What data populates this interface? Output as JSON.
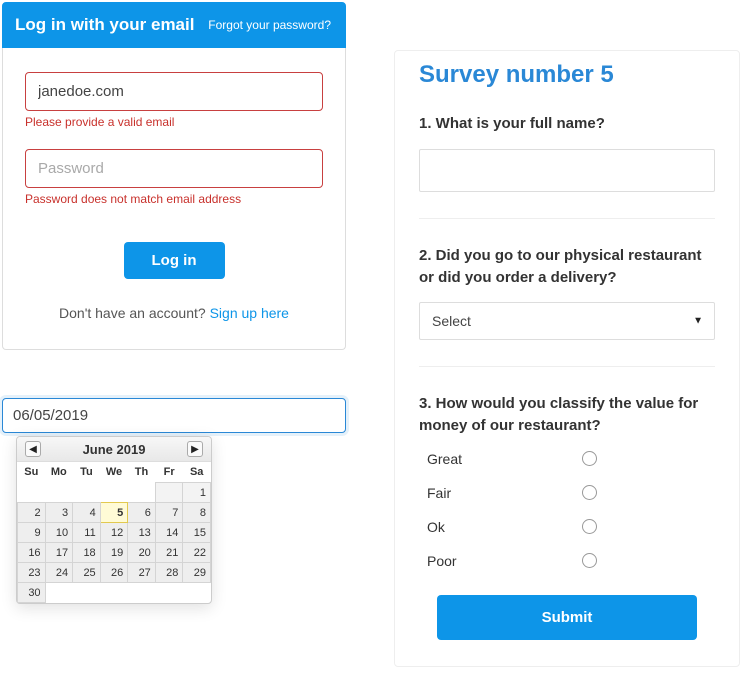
{
  "login": {
    "title": "Log in with your email",
    "forgot": "Forgot your password?",
    "email_value": "janedoe.com",
    "email_error": "Please provide a valid email",
    "password_placeholder": "Password",
    "password_error": "Password does not match email address",
    "button": "Log in",
    "signup_prompt": "Don't have an account?  ",
    "signup_link": "Sign up here"
  },
  "date": {
    "value": "06/05/2019",
    "month_label": "June 2019",
    "weekdays": [
      "Su",
      "Mo",
      "Tu",
      "We",
      "Th",
      "Fr",
      "Sa"
    ],
    "leading_blanks": 5,
    "trailing_filler": 1,
    "days_in_month": 30,
    "selected_day": 5
  },
  "survey": {
    "title": "Survey number 5",
    "q1": {
      "label": "1. What is your full name?"
    },
    "q2": {
      "label": "2. Did you go to our physical restaurant or did you order a delivery?",
      "placeholder": "Select"
    },
    "q3": {
      "label": "3. How would you classify the value for money of our restaurant?",
      "options": [
        "Great",
        "Fair",
        "Ok",
        "Poor"
      ]
    },
    "submit": "Submit"
  }
}
